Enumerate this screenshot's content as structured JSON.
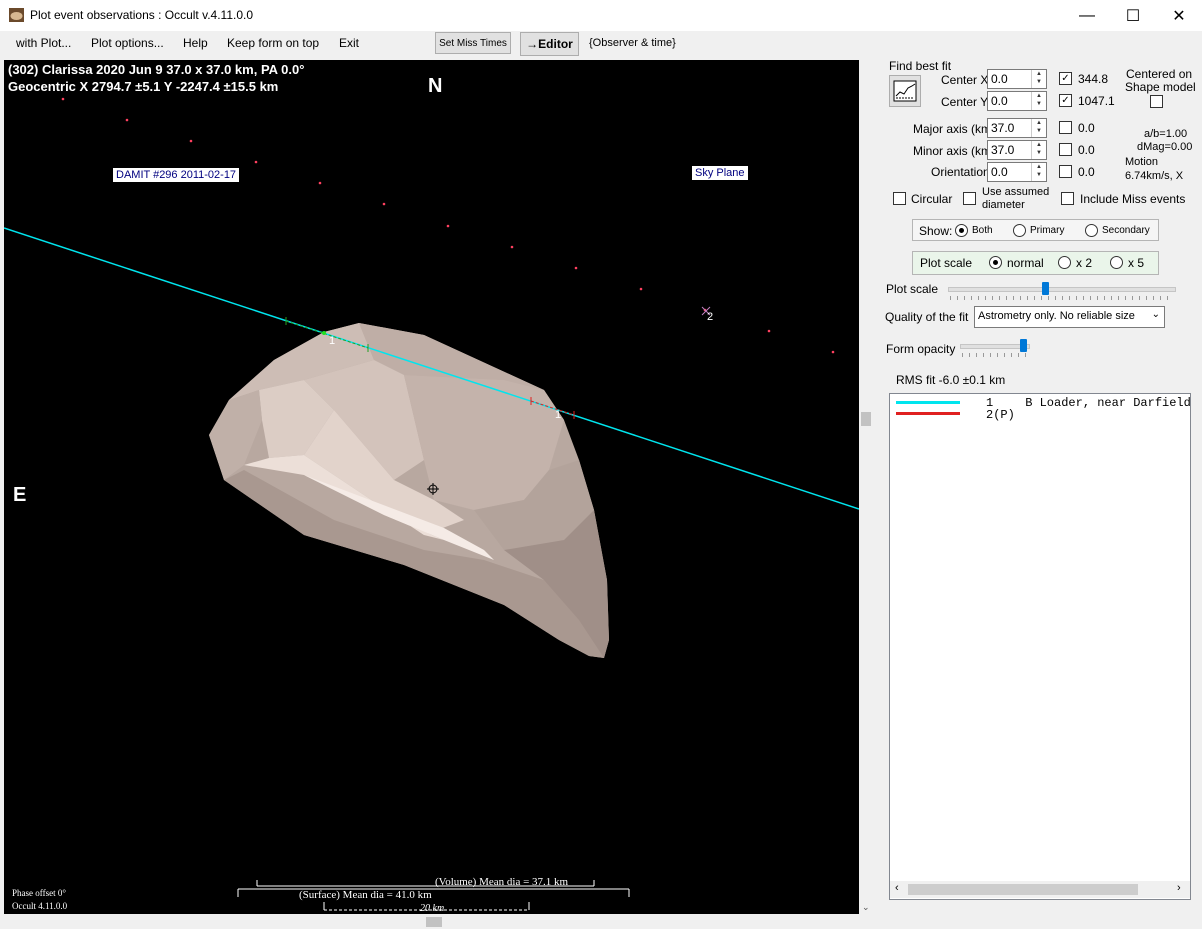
{
  "window": {
    "title": "Plot event observations : Occult v.4.11.0.0",
    "minimize": "—",
    "maximize": "☐",
    "close": "✕"
  },
  "menu": {
    "items": [
      "with Plot...",
      "Plot options...",
      "Help",
      "Keep form on top",
      "Exit"
    ],
    "set_miss_times": "Set Miss Times",
    "editor": "→Editor",
    "observer_time": "{Observer & time}"
  },
  "plot": {
    "header_line1": "(302) Clarissa  2020 Jun 9   37.0 x 37.0 km, PA 0.0°",
    "header_line2": "Geocentric  X  2794.7 ±5.1  Y -2247.4 ±15.5 km",
    "north": "N",
    "east": "E",
    "model_tag": "DAMIT #296 2011-02-17",
    "sky_plane": "Sky Plane",
    "chord1_label_a": "1",
    "chord1_label_b": "1",
    "chord2_label": "2",
    "phase_offset": "Phase offset 0°",
    "version": "Occult 4.11.0.0",
    "volume_dia": "(Volume) Mean dia = 37.1 km",
    "surface_dia": "(Surface) Mean dia = 41.0 km",
    "scale_bar": "20 km",
    "colors": {
      "chord": "#00e5ee",
      "shape": "#d8c8c0",
      "dots": "#ff4060"
    }
  },
  "panel": {
    "find_best_fit": "Find best fit",
    "center_x_label": "Center X",
    "center_x": "0.0",
    "center_y_label": "Center Y",
    "center_y": "0.0",
    "check_x_value": "344.8",
    "check_y_value": "1047.1",
    "centered_on": "Centered on",
    "shape_model": "Shape model",
    "major_axis_label": "Major axis (km)",
    "major_axis": "37.0",
    "major_check_value": "0.0",
    "minor_axis_label": "Minor axis (km)",
    "minor_axis": "37.0",
    "minor_check_value": "0.0",
    "orientation_label": "Orientation",
    "orientation": "0.0",
    "orientation_check_value": "0.0",
    "ab_ratio": "a/b=1.00",
    "dmag": "dMag=0.00",
    "motion_label": "Motion",
    "motion_value": "6.74km/s, X",
    "circular": "Circular",
    "use_assumed_1": "Use assumed",
    "use_assumed_2": "diameter",
    "include_miss": "Include Miss events",
    "show_label": "Show:",
    "show_options": [
      "Both",
      "Primary",
      "Secondary"
    ],
    "plot_scale_group": "Plot scale",
    "scale_options": [
      "normal",
      "x 2",
      "x 5"
    ],
    "plot_scale_slider": "Plot scale",
    "quality_label": "Quality of the fit",
    "quality_value": "Astrometry only. No reliable size",
    "form_opacity": "Form opacity",
    "rms_fit": "RMS fit -6.0 ±0.1 km",
    "list": [
      {
        "num": "1",
        "text": "B Loader, near Darfield"
      },
      {
        "num": "2(P)",
        "text": ""
      }
    ]
  }
}
